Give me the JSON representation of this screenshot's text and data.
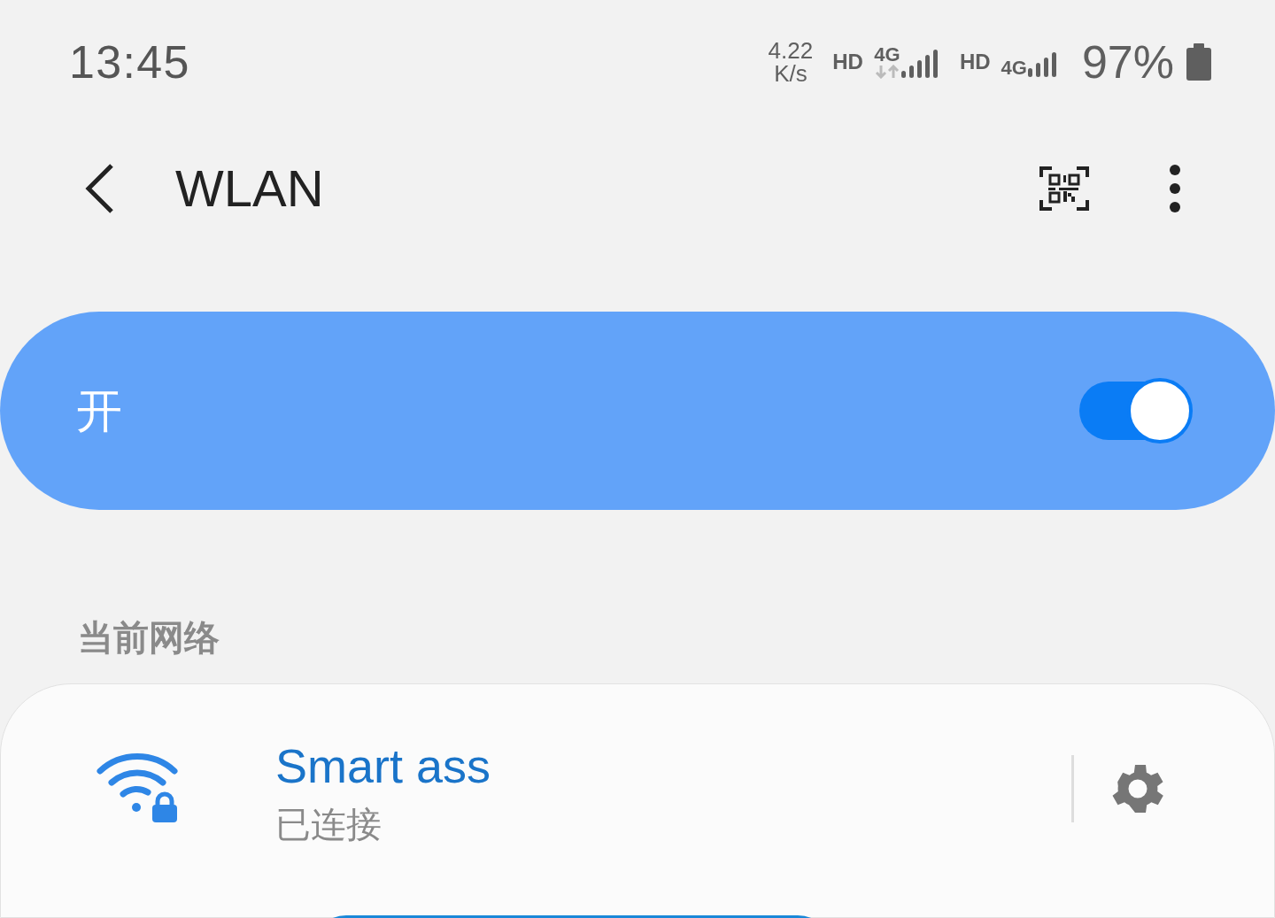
{
  "status_bar": {
    "time": "13:45",
    "speed_value": "4.22",
    "speed_unit": "K/s",
    "sims": [
      {
        "hd": "HD",
        "network": "4G",
        "data_arrows": true
      },
      {
        "hd": "HD",
        "network": "4G",
        "data_arrows": false
      }
    ],
    "battery": "97%"
  },
  "header": {
    "title": "WLAN"
  },
  "master_switch": {
    "label": "开",
    "on": true
  },
  "current_network": {
    "heading": "当前网络",
    "name": "Smart ass",
    "status": "已连接",
    "secured": true
  }
}
